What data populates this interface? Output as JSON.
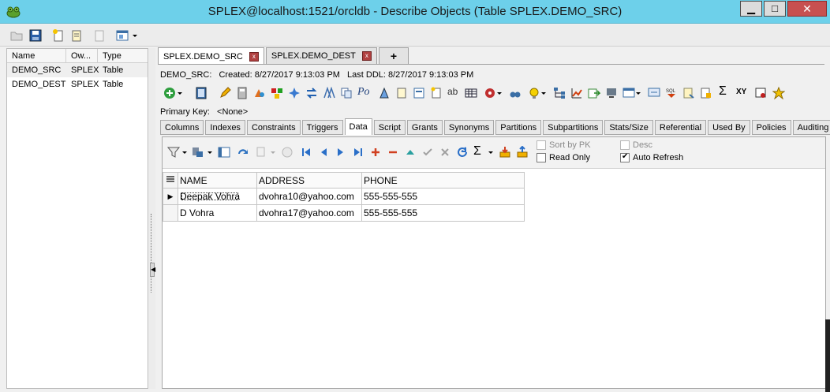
{
  "window": {
    "title": "SPLEX@localhost:1521/orcldb - Describe Objects (Table SPLEX.DEMO_SRC)",
    "minimize_glyph": "▁",
    "maximize_glyph": "□",
    "close_glyph": "✕"
  },
  "object_list": {
    "columns": [
      "Name",
      "Ow...",
      "Type"
    ],
    "rows": [
      {
        "name": "DEMO_SRC",
        "owner": "SPLEX",
        "type": "Table"
      },
      {
        "name": "DEMO_DEST",
        "owner": "SPLEX",
        "type": "Table"
      }
    ]
  },
  "doc_tabs": [
    {
      "label": "SPLEX.DEMO_SRC",
      "active": true
    },
    {
      "label": "SPLEX.DEMO_DEST",
      "active": false
    }
  ],
  "add_tab_label": "+",
  "close_tab_glyph": "x",
  "info": {
    "object": "DEMO_SRC:",
    "created": "Created: 8/27/2017 9:13:03 PM",
    "last_ddl": "Last DDL: 8/27/2017 9:13:03 PM"
  },
  "primary_key": {
    "label": "Primary Key:",
    "value": "<None>"
  },
  "sub_tabs": [
    "Columns",
    "Indexes",
    "Constraints",
    "Triggers",
    "Data",
    "Script",
    "Grants",
    "Synonyms",
    "Partitions",
    "Subpartitions",
    "Stats/Size",
    "Referential",
    "Used By",
    "Policies",
    "Auditing"
  ],
  "active_sub_tab": "Data",
  "data_options": {
    "sort_by_pk": {
      "label": "Sort by PK",
      "checked": false
    },
    "read_only": {
      "label": "Read Only",
      "checked": false
    },
    "desc": {
      "label": "Desc",
      "checked": false
    },
    "auto_refresh": {
      "label": "Auto Refresh",
      "checked": true
    }
  },
  "grid": {
    "columns": [
      "NAME",
      "ADDRESS",
      "PHONE"
    ],
    "rows": [
      {
        "indicator": "▶",
        "name": "Deepak Vohra",
        "address": "dvohra10@yahoo.com",
        "phone": "555-555-555"
      },
      {
        "indicator": "",
        "name": "D Vohra",
        "address": "dvohra17@yahoo.com",
        "phone": "555-555-555"
      }
    ]
  },
  "toolbar_icons": {
    "sum": "Σ",
    "xy": "XY",
    "po": "Po",
    "ab": "ab"
  }
}
